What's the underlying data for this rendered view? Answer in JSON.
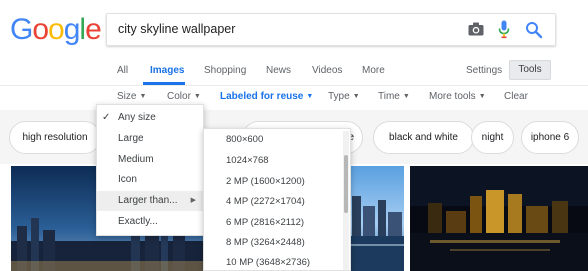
{
  "logo": {
    "letters": [
      "G",
      "o",
      "o",
      "g",
      "l",
      "e"
    ],
    "colors": [
      "#4285F4",
      "#EA4335",
      "#FBBC05",
      "#4285F4",
      "#34A853",
      "#EA4335"
    ]
  },
  "search": {
    "query": "city skyline wallpaper",
    "icons": [
      "camera-icon",
      "microphone-icon",
      "search-icon"
    ]
  },
  "tabs": {
    "all": "All",
    "images": "Images",
    "shopping": "Shopping",
    "news": "News",
    "videos": "Videos",
    "more": "More",
    "active": "Images"
  },
  "settings_label": "Settings",
  "tools_label": "Tools",
  "tools_row": {
    "size": "Size",
    "color": "Color",
    "labeled": "Labeled for reuse",
    "type": "Type",
    "time": "Time",
    "more_tools": "More tools",
    "clear": "Clear"
  },
  "chips": [
    "high resolution",
    "e",
    "black and white",
    "night",
    "iphone 6"
  ],
  "size_menu": {
    "items": [
      "Any size",
      "Large",
      "Medium",
      "Icon",
      "Larger than...",
      "Exactly..."
    ],
    "selected": "Any size",
    "highlighted": "Larger than..."
  },
  "larger_than_menu": {
    "items": [
      "800×600",
      "1024×768",
      "2 MP (1600×1200)",
      "4 MP (2272×1704)",
      "6 MP (2816×2112)",
      "8 MP (3264×2448)",
      "10 MP (3648×2736)"
    ]
  },
  "colors": {
    "accent": "#1a73e8",
    "text_secondary": "#5f6368",
    "tools_bg": "#e8eaed"
  }
}
